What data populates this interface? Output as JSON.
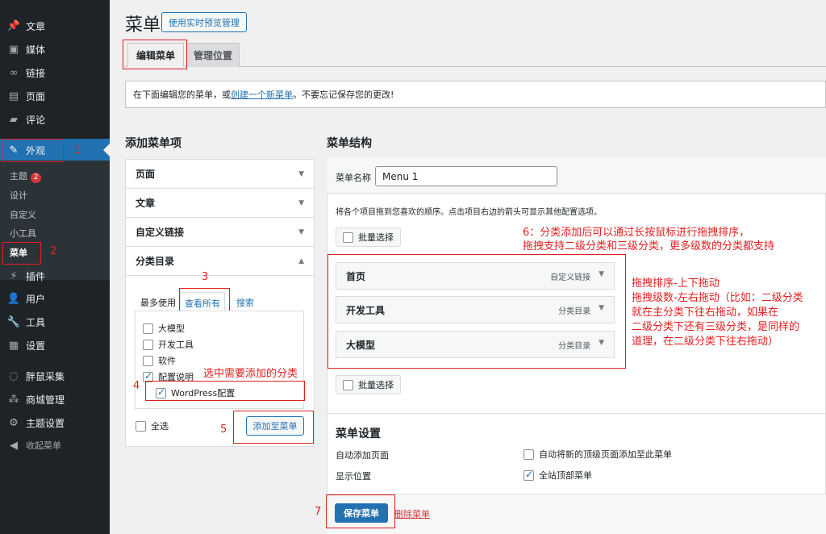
{
  "sidebar": {
    "items": [
      {
        "label": "文章",
        "icon": "pin-icon"
      },
      {
        "label": "媒体",
        "icon": "media-icon"
      },
      {
        "label": "链接",
        "icon": "link-icon"
      },
      {
        "label": "页面",
        "icon": "page-icon"
      },
      {
        "label": "评论",
        "icon": "comment-icon"
      },
      {
        "label": "外观",
        "icon": "brush-icon"
      },
      {
        "label": "插件",
        "icon": "plugin-icon"
      },
      {
        "label": "用户",
        "icon": "user-icon"
      },
      {
        "label": "工具",
        "icon": "wrench-icon"
      },
      {
        "label": "设置",
        "icon": "settings-icon"
      },
      {
        "label": "胖鼠采集",
        "icon": "mouse-icon"
      },
      {
        "label": "商城管理",
        "icon": "shop-icon"
      },
      {
        "label": "主题设置",
        "icon": "gear-icon"
      },
      {
        "label": "收起菜单",
        "icon": "collapse-icon"
      }
    ],
    "submenu": [
      {
        "label": "主题",
        "badge": "2"
      },
      {
        "label": "设计"
      },
      {
        "label": "自定义"
      },
      {
        "label": "小工具"
      },
      {
        "label": "菜单"
      }
    ]
  },
  "header": {
    "title": "菜单",
    "preview_button": "使用实时预览管理",
    "tabs": [
      "编辑菜单",
      "管理位置"
    ]
  },
  "notice": {
    "prefix": "在下面编辑您的菜单，或",
    "link": "创建一个新菜单",
    "suffix": "。不要忘记保存您的更改!"
  },
  "add_items": {
    "heading": "添加菜单项",
    "sections": [
      "页面",
      "文章",
      "自定义链接",
      "分类目录"
    ],
    "inner_tabs": [
      "最多使用",
      "查看所有",
      "搜索"
    ],
    "categories": [
      {
        "label": "大模型",
        "checked": false
      },
      {
        "label": "开发工具",
        "checked": false
      },
      {
        "label": "软件",
        "checked": false
      },
      {
        "label": "配置说明",
        "checked": true
      },
      {
        "label": "WordPress配置",
        "checked": true
      }
    ],
    "select_all": "全选",
    "add_button": "添加至菜单"
  },
  "structure": {
    "heading": "菜单结构",
    "name_label": "菜单名称",
    "name_value": "Menu 1",
    "hint": "将各个项目拖到您喜欢的顺序。点击项目右边的箭头可显示其他配置选项。",
    "bulk_select": "批量选择",
    "items": [
      {
        "title": "首页",
        "type": "自定义链接"
      },
      {
        "title": "开发工具",
        "type": "分类目录"
      },
      {
        "title": "大模型",
        "type": "分类目录"
      }
    ],
    "settings_heading": "菜单设置",
    "auto_add_label": "自动添加页面",
    "auto_add_option": "自动将新的顶级页面添加至此菜单",
    "location_label": "显示位置",
    "location_option": "全站顶部菜单",
    "save_button": "保存菜单",
    "delete_link": "删除菜单"
  },
  "annotations": {
    "n1": "1",
    "n2": "2",
    "n3": "3",
    "n4": "4",
    "n5": "5",
    "n7": "7",
    "select_cat": "选中需要添加的分类",
    "step6_line1": "6：分类添加后可以通过长按鼠标进行拖拽排序，",
    "step6_line2": "拖拽支持二级分类和三级分类，更多级数的分类都支持",
    "drag_lines": [
      "拖拽排序-上下拖动",
      "拖拽级数-左右拖动（比如：二级分类",
      "就在主分类下往右拖动，如果在",
      "二级分类下还有三级分类，是同样的",
      "道理，在二级分类下往右拖动）"
    ]
  },
  "colors": {
    "accent": "#2271b1",
    "sidebar": "#1d2327",
    "annotation": "#e02020"
  }
}
